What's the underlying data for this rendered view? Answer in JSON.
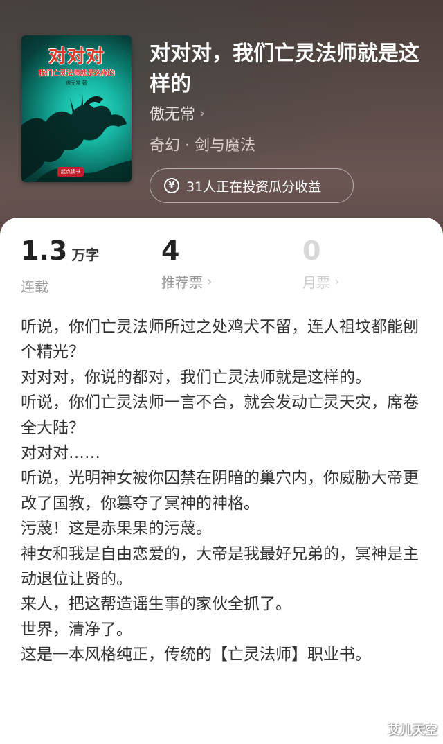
{
  "cover": {
    "title": "对对对",
    "subtitle": "我们亡灵法师就是这样的",
    "author": "傲无常 著",
    "publisher_badge": "起点读书"
  },
  "book": {
    "title": "对对对，我们亡灵法师就是这样的",
    "author": "傲无常",
    "genre": "奇幻 · 剑与魔法",
    "invest_text": "31人正在投资瓜分收益"
  },
  "stats": [
    {
      "value": "1.3",
      "unit": "万字",
      "label": "连载"
    },
    {
      "value": "4",
      "unit": "",
      "label": "推荐票"
    },
    {
      "value": "0",
      "unit": "",
      "label": "月票"
    }
  ],
  "synopsis": [
    "听说，你们亡灵法师所过之处鸡犬不留，连人祖坟都能刨个精光？",
    "对对对，你说的都对，我们亡灵法师就是这样的。",
    "听说，你们亡灵法师一言不合，就会发动亡灵天灾，席卷全大陆？",
    "对对对……",
    "听说，光明神女被你囚禁在阴暗的巢穴内，你威胁大帝更改了国教，你篡夺了冥神的神格。",
    "污蔑！这是赤果果的污蔑。",
    "神女和我是自由恋爱的，大帝是我最好兄弟的，冥神是主动退位让贤的。",
    "来人，把这帮造谣生事的家伙全抓了。",
    "世界，清净了。",
    "这是一本风格纯正，传统的【亡灵法师】职业书。"
  ],
  "watermark": "艾儿天空",
  "colors": {
    "header_bg": "#5a4a47",
    "cover_glow": "#2fe0c9",
    "cover_title": "#e23a2a",
    "text_primary": "#333333",
    "text_muted": "#999999"
  }
}
